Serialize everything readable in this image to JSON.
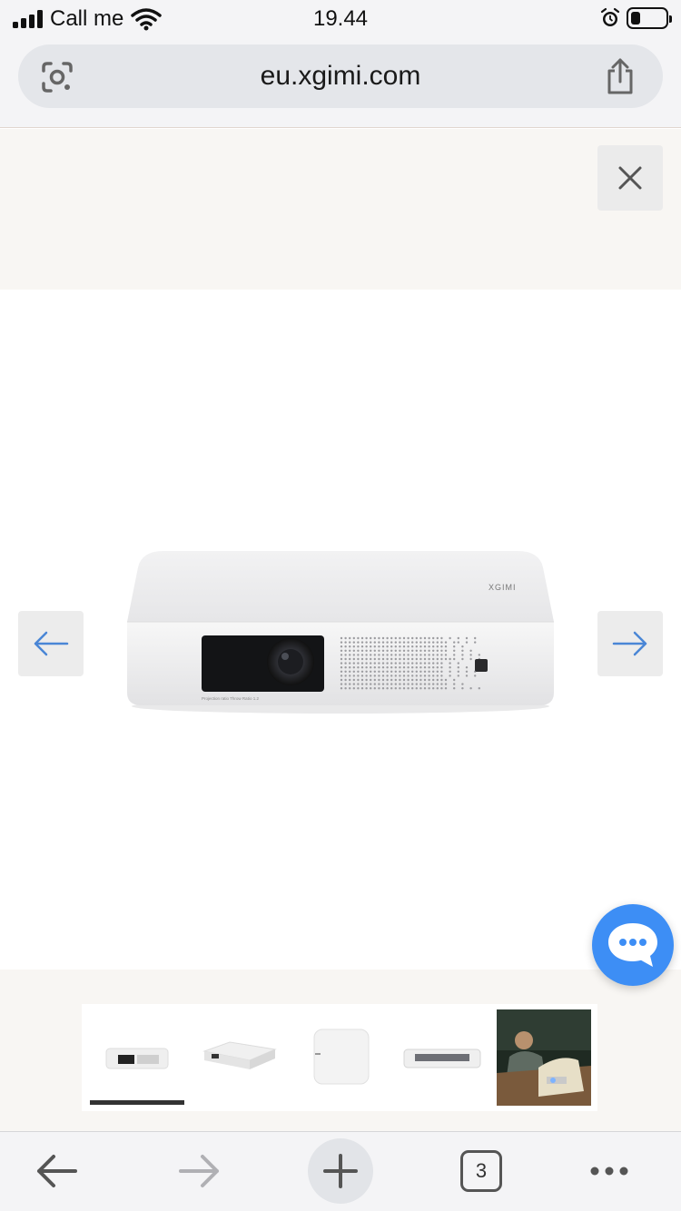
{
  "status_bar": {
    "carrier": "Call me",
    "time": "19.44",
    "signal_bars": 4,
    "battery_level": 0.2
  },
  "browser": {
    "url": "eu.xgimi.com",
    "open_tabs_count": "3"
  },
  "carousel": {
    "product_image": "white-xgimi-projector",
    "brand_mark": "XGIMI",
    "lens_caption": "Projection ratio Throw Ratio 1.2",
    "active_thumbnail_index": 0,
    "thumbnails": [
      "projector-front-view",
      "projector-angled-view",
      "projector-top-view",
      "projector-side-view",
      "lifestyle-photo-man-on-sofa"
    ]
  },
  "colors": {
    "accent_blue": "#3d8ef5",
    "arrow_blue": "#4a86d6",
    "beige_background": "#f8f6f3",
    "browser_chrome": "#f4f4f6"
  },
  "icons": {
    "close": "close-icon",
    "prev": "arrow-left-icon",
    "next": "arrow-right-icon",
    "chat": "chat-bubble-icon",
    "share": "share-icon",
    "lens": "google-lens-icon",
    "back": "back-arrow-icon",
    "forward": "forward-arrow-icon",
    "new_tab": "plus-icon",
    "more": "more-dots-icon"
  }
}
